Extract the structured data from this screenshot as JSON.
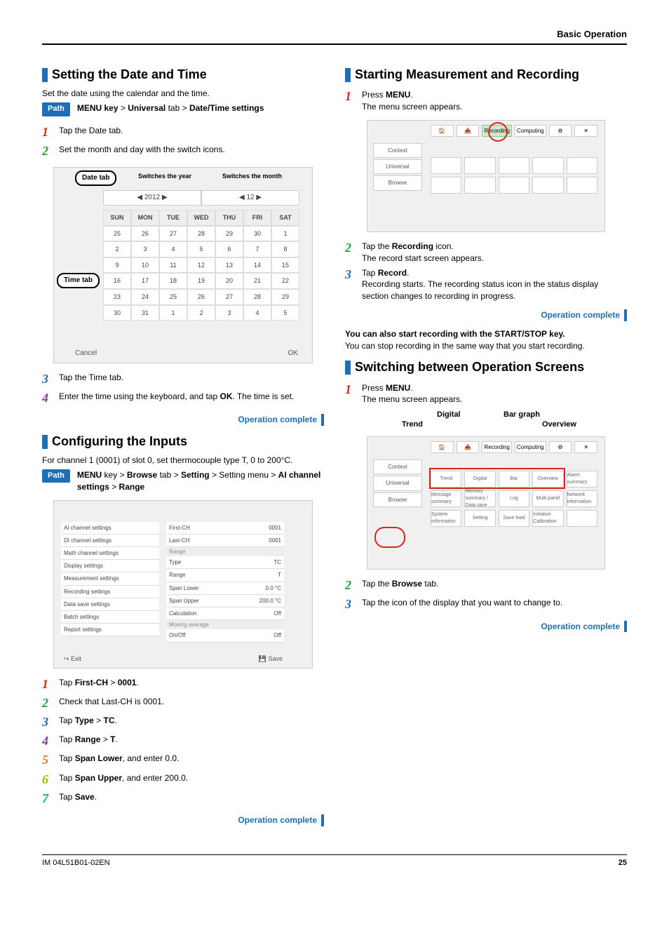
{
  "header": "Basic Operation",
  "left": {
    "sec1": {
      "title": "Setting the Date and Time",
      "intro": "Set the date using the calendar and the time.",
      "path": "MENU key > Universal tab > Date/Time settings",
      "steps_a": [
        {
          "n": "1",
          "cls": "c1",
          "t": "Tap the Date tab."
        },
        {
          "n": "2",
          "cls": "c2",
          "t": "Set the month and day with the switch icons."
        }
      ],
      "callouts": {
        "date_tab": "Date tab",
        "time_tab": "Time tab",
        "sw_year": "Switches the year",
        "sw_month": "Switches the month"
      },
      "calendar": {
        "year": "2012",
        "month": "12",
        "dow": [
          "SUN",
          "MON",
          "TUE",
          "WED",
          "THU",
          "FRI",
          "SAT"
        ],
        "rows": [
          [
            "25",
            "26",
            "27",
            "28",
            "29",
            "30",
            "1"
          ],
          [
            "2",
            "3",
            "4",
            "5",
            "6",
            "7",
            "8"
          ],
          [
            "9",
            "10",
            "11",
            "12",
            "13",
            "14",
            "15"
          ],
          [
            "16",
            "17",
            "18",
            "19",
            "20",
            "21",
            "22"
          ],
          [
            "23",
            "24",
            "25",
            "26",
            "27",
            "28",
            "29"
          ],
          [
            "30",
            "31",
            "1",
            "2",
            "3",
            "4",
            "5"
          ]
        ],
        "cancel": "Cancel",
        "ok": "OK"
      },
      "steps_b": [
        {
          "n": "3",
          "cls": "c3",
          "t": "Tap the Time tab."
        },
        {
          "n": "4",
          "cls": "c4",
          "t": "Enter the time using the keyboard, and tap OK. The time is set.",
          "bold": "OK"
        }
      ],
      "oc": "Operation complete"
    },
    "sec2": {
      "title": "Configuring the Inputs",
      "intro": "For channel 1 (0001) of slot 0, set thermocouple type T, 0 to 200°C.",
      "path_pre": "MENU key > Browse tab > Setting > ",
      "path_post": "Setting menu > AI channel settings > Range",
      "left_items": [
        "AI channel settings",
        "DI channel settings",
        "Math channel settings",
        "Display settings",
        "Measurement settings",
        "Recording settings",
        "Data save settings",
        "Batch settings",
        "Report settings"
      ],
      "range_items": [
        {
          "k": "First-CH",
          "v": "0001",
          "n": "1",
          "cls": "c1"
        },
        {
          "k": "Last-CH",
          "v": "0001",
          "n": "2",
          "cls": "c2"
        },
        {
          "k": "Type",
          "v": "TC",
          "n": "3",
          "cls": "c3",
          "hdr": "Range"
        },
        {
          "k": "Range",
          "v": "T",
          "n": "4",
          "cls": "c4"
        },
        {
          "k": "Span Lower",
          "v": "0.0 °C",
          "n": "5",
          "cls": "c5"
        },
        {
          "k": "Span Upper",
          "v": "200.0 °C",
          "n": "6",
          "cls": "c6"
        },
        {
          "k": "Calculation",
          "v": "Off"
        },
        {
          "k": "On/Off",
          "v": "Off",
          "hdr": "Moving average"
        }
      ],
      "exit": "Exit",
      "save": "Save",
      "save_n": "7",
      "save_cls": "c7",
      "steps": [
        {
          "n": "1",
          "cls": "c1",
          "html": "Tap <b>First-CH</b> > <b>0001</b>."
        },
        {
          "n": "2",
          "cls": "c2",
          "html": "Check that Last-CH is 0001."
        },
        {
          "n": "3",
          "cls": "c3",
          "html": "Tap <b>Type</b> > <b>TC</b>."
        },
        {
          "n": "4",
          "cls": "c4",
          "html": "Tap <b>Range</b> > <b>T</b>."
        },
        {
          "n": "5",
          "cls": "c5",
          "html": "Tap <b>Span Lower</b>, and enter 0.0."
        },
        {
          "n": "6",
          "cls": "c6",
          "html": "Tap <b>Span Upper</b>, and enter 200.0."
        },
        {
          "n": "7",
          "cls": "c7",
          "html": "Tap <b>Save</b>."
        }
      ],
      "oc": "Operation complete"
    }
  },
  "right": {
    "sec1": {
      "title": "Starting Measurement and Recording",
      "steps_a": [
        {
          "n": "1",
          "cls": "c1",
          "html": "Press <b>MENU</b>.<br>The menu screen appears."
        }
      ],
      "side_menu": [
        "Context",
        "Universal",
        "Browse"
      ],
      "top_tabs": [
        "Recording",
        "Computing"
      ],
      "steps_b": [
        {
          "n": "2",
          "cls": "c2",
          "html": "Tap the <b>Recording</b> icon.<br>The record start screen appears."
        },
        {
          "n": "3",
          "cls": "c3",
          "html": "Tap <b>Record</b>.<br>Recording starts. The recording status icon in the status display section changes to recording in progress."
        }
      ],
      "oc": "Operation complete",
      "note_title": "You can also start recording with the START/STOP key.",
      "note_body": "You can stop recording in the same way that you start recording."
    },
    "sec2": {
      "title": "Switching between Operation Screens",
      "steps_a": [
        {
          "n": "1",
          "cls": "c1",
          "html": "Press <b>MENU</b>.<br>The menu screen appears."
        }
      ],
      "graph_labels": {
        "digital": "Digital",
        "bar": "Bar graph",
        "trend": "Trend",
        "overview": "Overview"
      },
      "side_menu": [
        "Context",
        "Universal",
        "Browse"
      ],
      "grid_labels": [
        "Trend",
        "Digital",
        "Bar",
        "Overview",
        "Alarm summary",
        "Message summary",
        "Memory summary / Data save",
        "Log",
        "Multi panel",
        "Network information",
        "System information",
        "Setting",
        "Save load",
        "Initialize Calibration"
      ],
      "steps_b": [
        {
          "n": "2",
          "cls": "c2",
          "html": "Tap the <b>Browse</b> tab."
        },
        {
          "n": "3",
          "cls": "c3",
          "html": "Tap the icon of the display that you want to change to."
        }
      ],
      "oc": "Operation complete"
    }
  },
  "path_label": "Path",
  "footer": {
    "left": "IM 04L51B01-02EN",
    "right": "25"
  }
}
